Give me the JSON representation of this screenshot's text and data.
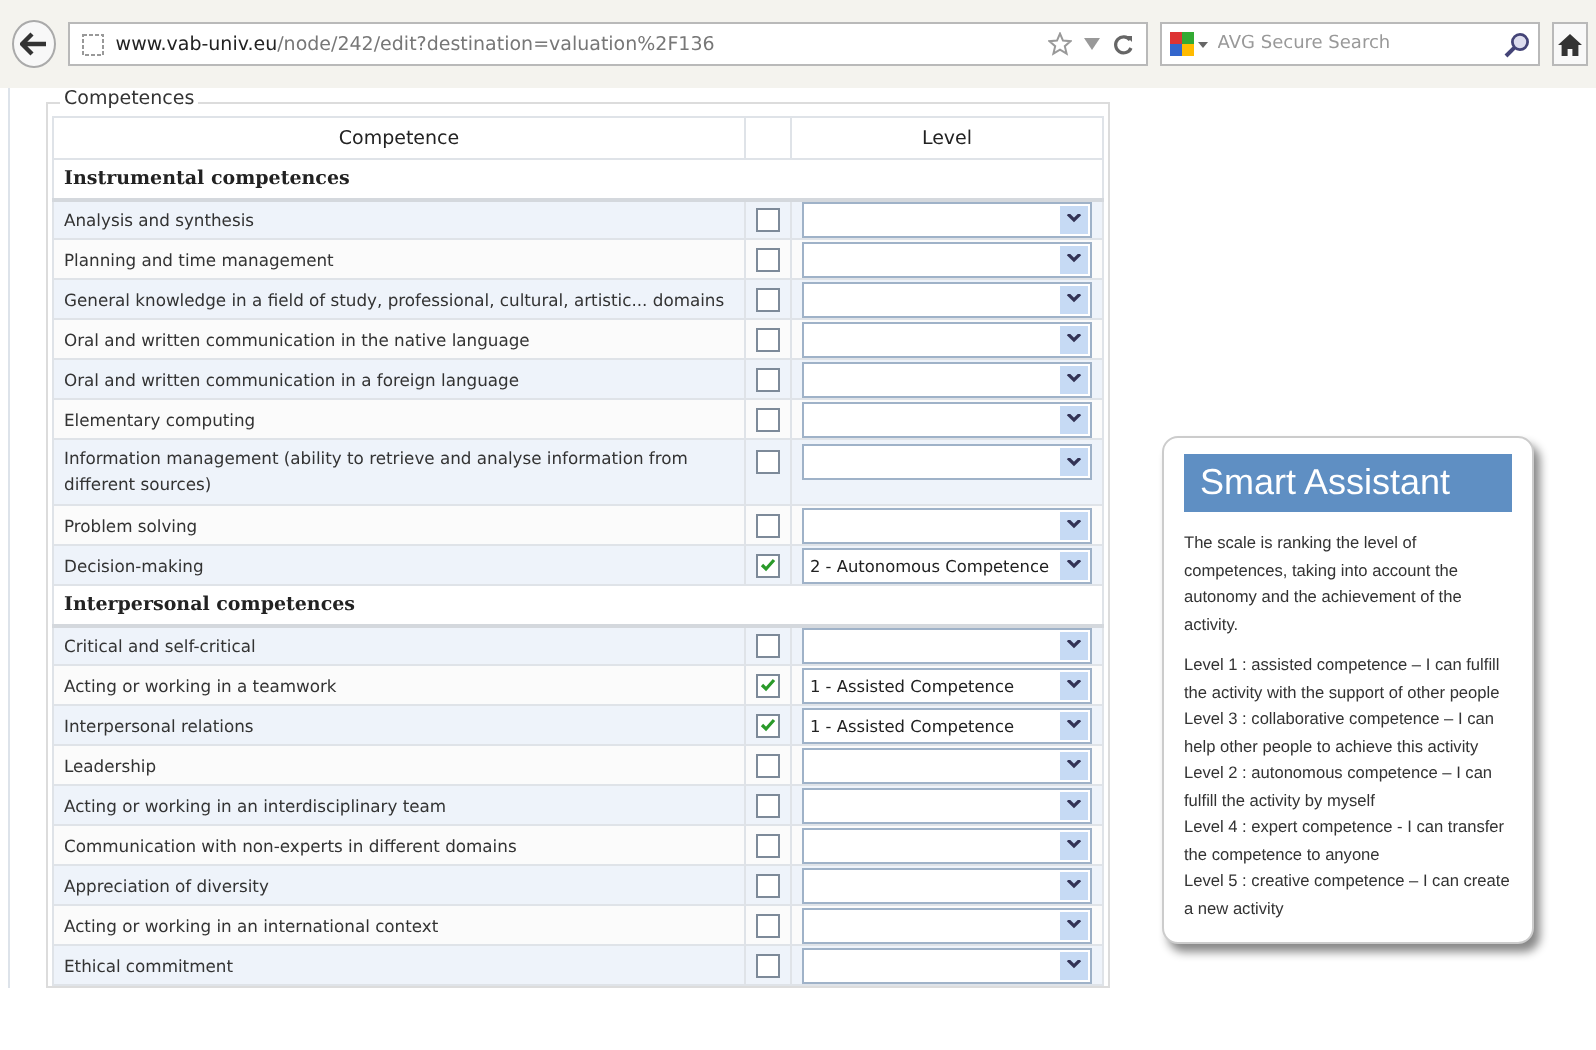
{
  "browser": {
    "url_host": "www.vab-univ.eu",
    "url_path": "/node/242/edit?destination=valuation%2F136",
    "search_placeholder": "AVG Secure Search"
  },
  "fieldset": {
    "legend": "Competences"
  },
  "table": {
    "columns": [
      "Competence",
      "Level"
    ],
    "rows": [
      {
        "kind": "group",
        "label": "Instrumental competences"
      },
      {
        "kind": "item",
        "label": "Analysis and synthesis",
        "checked": false
      },
      {
        "kind": "item",
        "label": "Planning and time management",
        "checked": false
      },
      {
        "kind": "item",
        "label": "General knowledge in a field of study, professional, cultural, artistic... domains",
        "checked": false
      },
      {
        "kind": "item",
        "label": "Oral and written communication in the native language",
        "checked": false
      },
      {
        "kind": "item",
        "label": "Oral and written communication in a foreign language",
        "checked": false
      },
      {
        "kind": "item",
        "label": "Elementary computing",
        "checked": false
      },
      {
        "kind": "item",
        "label": "Information management (ability to retrieve and analyse information from different sources)",
        "checked": false
      },
      {
        "kind": "item",
        "label": "Problem solving",
        "checked": false
      },
      {
        "kind": "item",
        "label": "Decision-making",
        "checked": true,
        "level": "2 - Autonomous Competence"
      },
      {
        "kind": "group",
        "label": "Interpersonal competences"
      },
      {
        "kind": "item",
        "label": "Critical and self-critical",
        "checked": false
      },
      {
        "kind": "item",
        "label": "Acting or working in a teamwork",
        "checked": true,
        "level": "1 - Assisted Competence"
      },
      {
        "kind": "item",
        "label": "Interpersonal relations",
        "checked": true,
        "level": "1 - Assisted Competence"
      },
      {
        "kind": "item",
        "label": "Leadership",
        "checked": false
      },
      {
        "kind": "item",
        "label": "Acting or working in an interdisciplinary team",
        "checked": false
      },
      {
        "kind": "item",
        "label": "Communication with non-experts in different domains",
        "checked": false
      },
      {
        "kind": "item",
        "label": "Appreciation of diversity",
        "checked": false
      },
      {
        "kind": "item",
        "label": "Acting or working in an international context",
        "checked": false
      },
      {
        "kind": "item",
        "label": "Ethical commitment",
        "checked": false
      }
    ]
  },
  "assistant": {
    "title": "Smart Assistant",
    "intro": "The scale is ranking the level of competences, taking into account the autonomy and the achievement of the activity.",
    "levels": [
      "Level 1 : assisted competence – I can fulfill the activity with the support of other people",
      "Level 3 : collaborative competence – I can help other people to achieve this activity",
      "Level 2 : autonomous competence – I can fulfill the activity by myself",
      "Level 4 : expert competence - I can transfer the competence to anyone",
      "Level 5 : creative competence – I can create a new activity"
    ]
  }
}
